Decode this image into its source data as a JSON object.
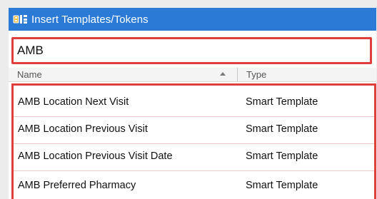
{
  "window": {
    "title": "Insert Templates/Tokens",
    "icon": "templates-icon"
  },
  "search": {
    "value": "AMB",
    "placeholder": ""
  },
  "table": {
    "columns": [
      {
        "label": "Name",
        "sort": "ascending"
      },
      {
        "label": "Type"
      }
    ],
    "rows": [
      {
        "name": "AMB Location Next Visit",
        "type": "Smart Template"
      },
      {
        "name": "AMB Location Previous Visit",
        "type": "Smart Template"
      },
      {
        "name": "AMB Location Previous Visit Date",
        "type": "Smart Template"
      },
      {
        "name": "AMB Preferred Pharmacy",
        "type": "Smart Template"
      }
    ]
  },
  "colors": {
    "titlebar": "#2b7bd6",
    "highlight_border": "#e0403d"
  }
}
